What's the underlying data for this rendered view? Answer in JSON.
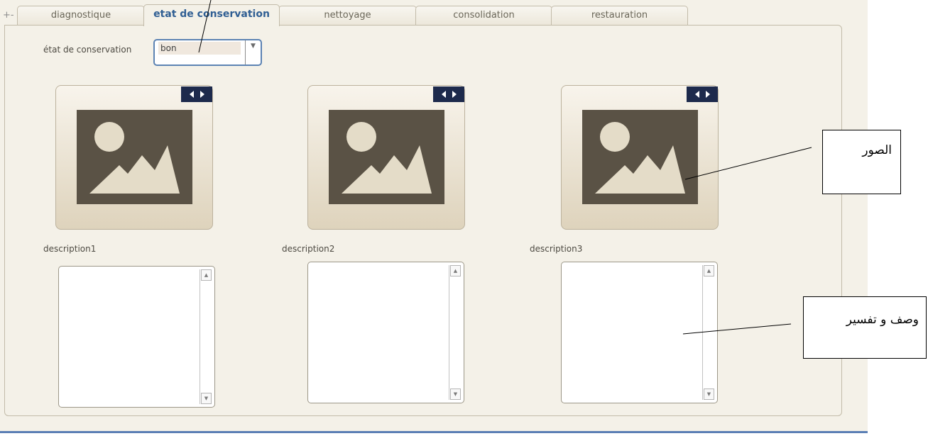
{
  "tabs": [
    {
      "label": "diagnostique",
      "active": false
    },
    {
      "label": "etat de conservation",
      "active": true
    },
    {
      "label": "nettoyage",
      "active": false
    },
    {
      "label": "consolidation",
      "active": false
    },
    {
      "label": "restauration",
      "active": false
    }
  ],
  "collapse_icon": "+-",
  "state_field": {
    "label": "état de conservation",
    "value": "bon",
    "dropdown_icon": "▼"
  },
  "images": [
    {
      "nav_icons": [
        "prev-arrow-icon",
        "next-arrow-icon"
      ],
      "placeholder_icon": "image-placeholder-icon"
    },
    {
      "nav_icons": [
        "prev-arrow-icon",
        "next-arrow-icon"
      ],
      "placeholder_icon": "image-placeholder-icon"
    },
    {
      "nav_icons": [
        "prev-arrow-icon",
        "next-arrow-icon"
      ],
      "placeholder_icon": "image-placeholder-icon"
    }
  ],
  "descriptions": [
    {
      "label": "description1"
    },
    {
      "label": "description2"
    },
    {
      "label": "description3"
    }
  ],
  "scroll_arrows": {
    "up": "▲",
    "down": "▼"
  },
  "annotations": {
    "images_callout": "الصور",
    "description_callout": "وصف و تفسير"
  },
  "colors": {
    "active_tab_text": "#2f5e93",
    "nav_bar": "#1d2a4c",
    "image_placeholder": "#5a5245",
    "panel_background": "#f4f1e8",
    "bottom_line": "#5b7fb5"
  }
}
